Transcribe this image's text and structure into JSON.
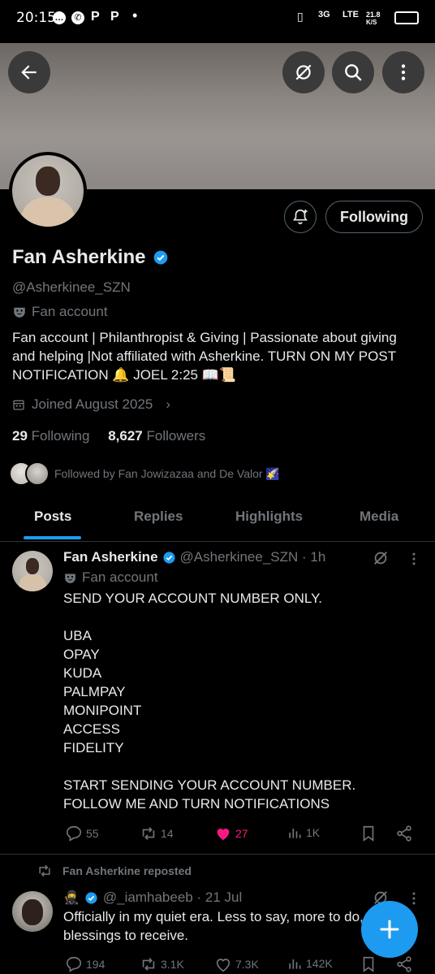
{
  "status_bar": {
    "time": "20:15",
    "apps": [
      "P",
      "P"
    ],
    "network": "3G",
    "lte": "LTE",
    "speed_top": "21.8",
    "speed_unit": "K/S"
  },
  "header": {
    "back_icon": "arrow-left-icon",
    "grok_icon": "grok-icon",
    "search_icon": "search-icon",
    "more_icon": "more-vertical-icon"
  },
  "profile": {
    "name": "Fan Asherkine",
    "handle": "@Asherkinee_SZN",
    "label": "Fan account",
    "bio": "Fan account | Philanthropist & Giving | Passionate about giving and helping |Not affiliated with Asherkine. TURN ON MY POST NOTIFICATION 🔔 JOEL 2:25 📖📜",
    "joined": "Joined August 2025",
    "following_count": "29",
    "following_label": "Following",
    "followers_count": "8,627",
    "followers_label": "Followers",
    "followed_by": "Followed by Fan Jowizazaa and De Valor 🌠",
    "follow_button": "Following"
  },
  "tabs": [
    {
      "label": "Posts"
    },
    {
      "label": "Replies"
    },
    {
      "label": "Highlights"
    },
    {
      "label": "Media"
    }
  ],
  "post1": {
    "name": "Fan Asherkine",
    "handle": "@Asherkinee_SZN · 1h",
    "label": "Fan account",
    "text": "SEND YOUR ACCOUNT NUMBER ONLY.\n\nUBA\nOPAY\nKUDA\nPALMPAY\nMONIPOINT\nACCESS\nFIDELITY\n\nSTART SENDING YOUR ACCOUNT NUMBER.\nFOLLOW ME AND TURN NOTIFICATIONS",
    "replies": "55",
    "reposts": "14",
    "likes": "27",
    "views": "1K"
  },
  "post2": {
    "repost_label": "Fan Asherkine reposted",
    "emoji": "🥷",
    "handle": "@_iamhabeeb · 21 Jul",
    "text": "Officially in my quiet era. Less to say, more to do, blessings to receive.",
    "replies": "194",
    "reposts": "3.1K",
    "likes": "7.3K",
    "views": "142K"
  },
  "colors": {
    "accent": "#1d9bf0",
    "like": "#f91880",
    "muted": "#71767b"
  }
}
